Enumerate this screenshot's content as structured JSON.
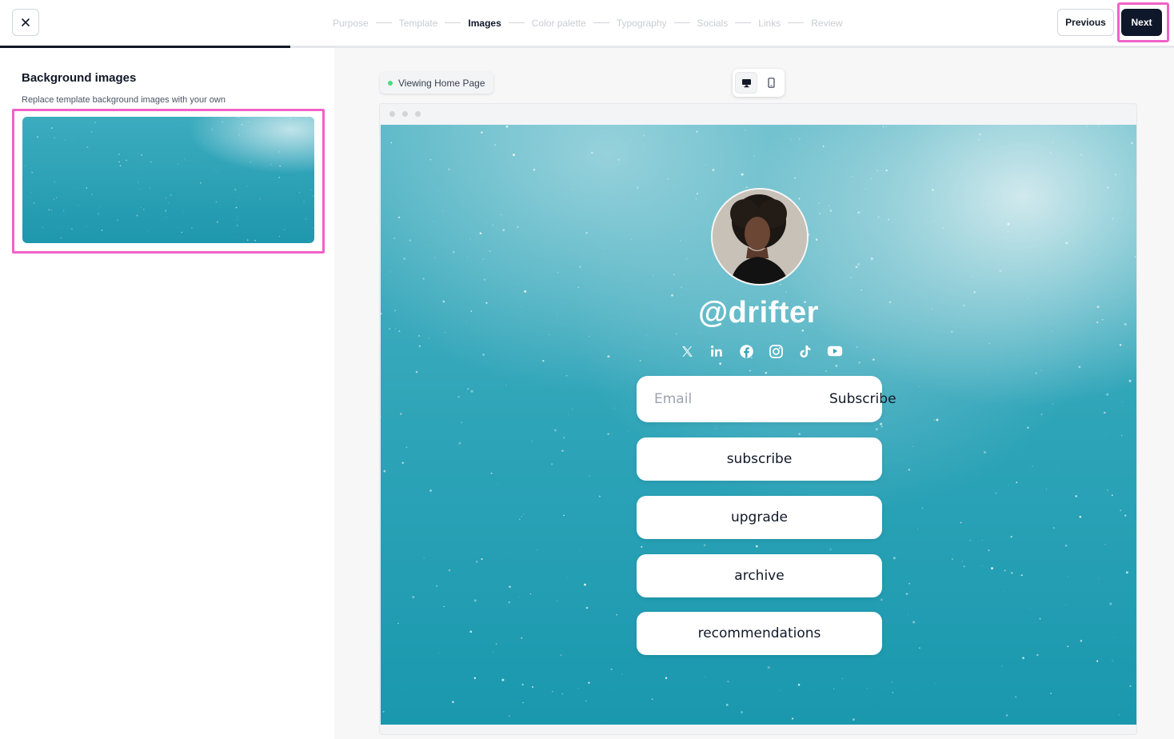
{
  "topbar": {
    "steps": [
      "Purpose",
      "Template",
      "Images",
      "Color palette",
      "Typography",
      "Socials",
      "Links",
      "Review"
    ],
    "active_step": "Images",
    "progress_fraction": 0.247,
    "previous_label": "Previous",
    "next_label": "Next"
  },
  "left_panel": {
    "title": "Background images",
    "subtitle": "Replace template background images with your own"
  },
  "preview": {
    "viewing_label": "Viewing Home Page",
    "device_modes": [
      "desktop",
      "mobile"
    ],
    "active_device": "desktop"
  },
  "site": {
    "handle": "@drifter",
    "socials": [
      "x-icon",
      "linkedin-icon",
      "facebook-icon",
      "instagram-icon",
      "tiktok-icon",
      "youtube-icon"
    ],
    "email_placeholder": "Email",
    "subscribe_label": "Subscribe",
    "links": [
      "subscribe",
      "upgrade",
      "archive",
      "recommendations"
    ]
  },
  "colors": {
    "accent_highlight": "#f062c8",
    "primary_button": "#0f172a",
    "background_teal": "#2ea4b8",
    "status_dot": "#4ade80"
  }
}
